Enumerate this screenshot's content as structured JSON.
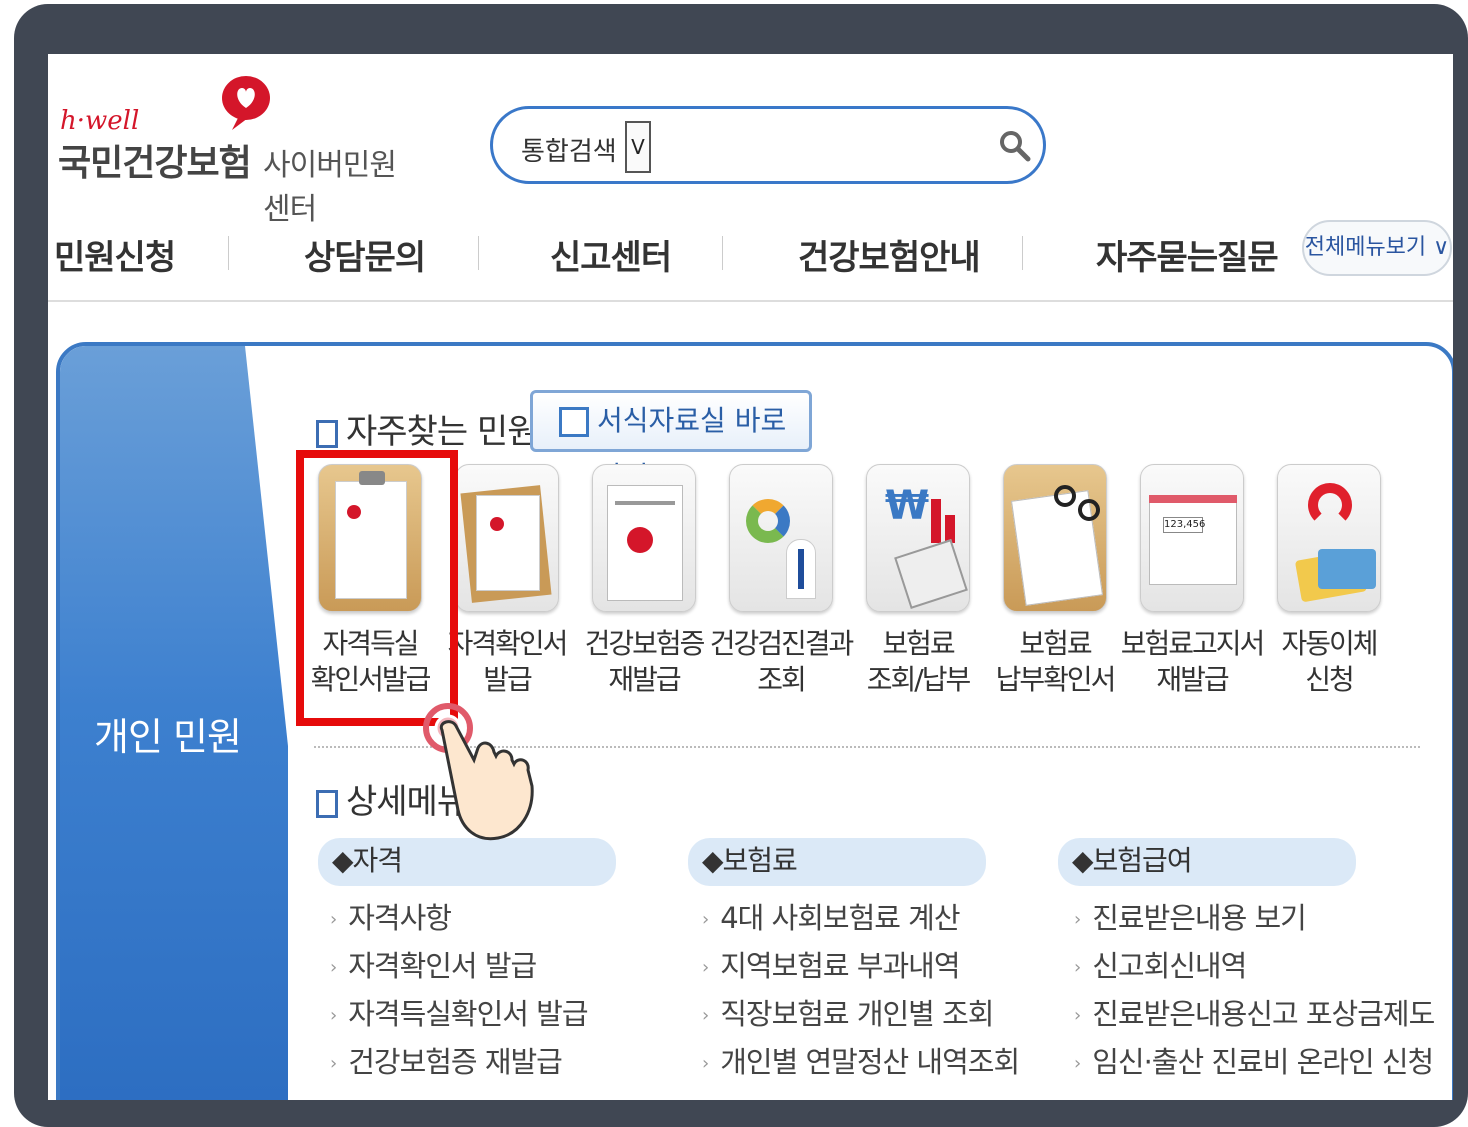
{
  "header": {
    "logo_brand": "h·well",
    "logo_org": "국민건강보험",
    "logo_sub": "사이버민원센터",
    "search_label": "통합검색",
    "search_select": "V"
  },
  "gnb": {
    "items": [
      "민원신청",
      "상담문의",
      "신고센터",
      "건강보험안내",
      "자주묻는질문"
    ],
    "all_menu": "전체메뉴보기 ∨"
  },
  "side": {
    "title": "개인 민원"
  },
  "frequent": {
    "title": "자주찾는 민원",
    "form_button": "서식자료실 바로가기",
    "tiles": [
      {
        "l1": "자격득실",
        "l2": "확인서발급"
      },
      {
        "l1": "자격확인서",
        "l2": "발급"
      },
      {
        "l1": "건강보험증",
        "l2": "재발급"
      },
      {
        "l1": "건강검진결과",
        "l2": "조회"
      },
      {
        "l1": "보험료",
        "l2": "조회/납부"
      },
      {
        "l1": "보험료",
        "l2": "납부확인서"
      },
      {
        "l1": "보험료고지서",
        "l2": "재발급"
      },
      {
        "l1": "자동이체",
        "l2": "신청"
      }
    ]
  },
  "detail": {
    "title": "상세메뉴보",
    "categories": [
      {
        "name": "◆자격",
        "items": [
          "자격사항",
          "자격확인서 발급",
          "자격득실확인서 발급",
          "건강보험증 재발급"
        ]
      },
      {
        "name": "◆보험료",
        "items": [
          "4대 사회보험료 계산",
          "지역보험료 부과내역",
          "직장보험료 개인별 조회",
          "개인별 연말정산 내역조회"
        ]
      },
      {
        "name": "◆보험급여",
        "items": [
          "진료받은내용 보기",
          "신고회신내역",
          "진료받은내용신고 포상금제도",
          "임신·출산 진료비 온라인 신청"
        ]
      }
    ]
  },
  "colors": {
    "accent": "#3b79c4",
    "highlight": "#e60b0b",
    "brand": "#d4162a"
  }
}
